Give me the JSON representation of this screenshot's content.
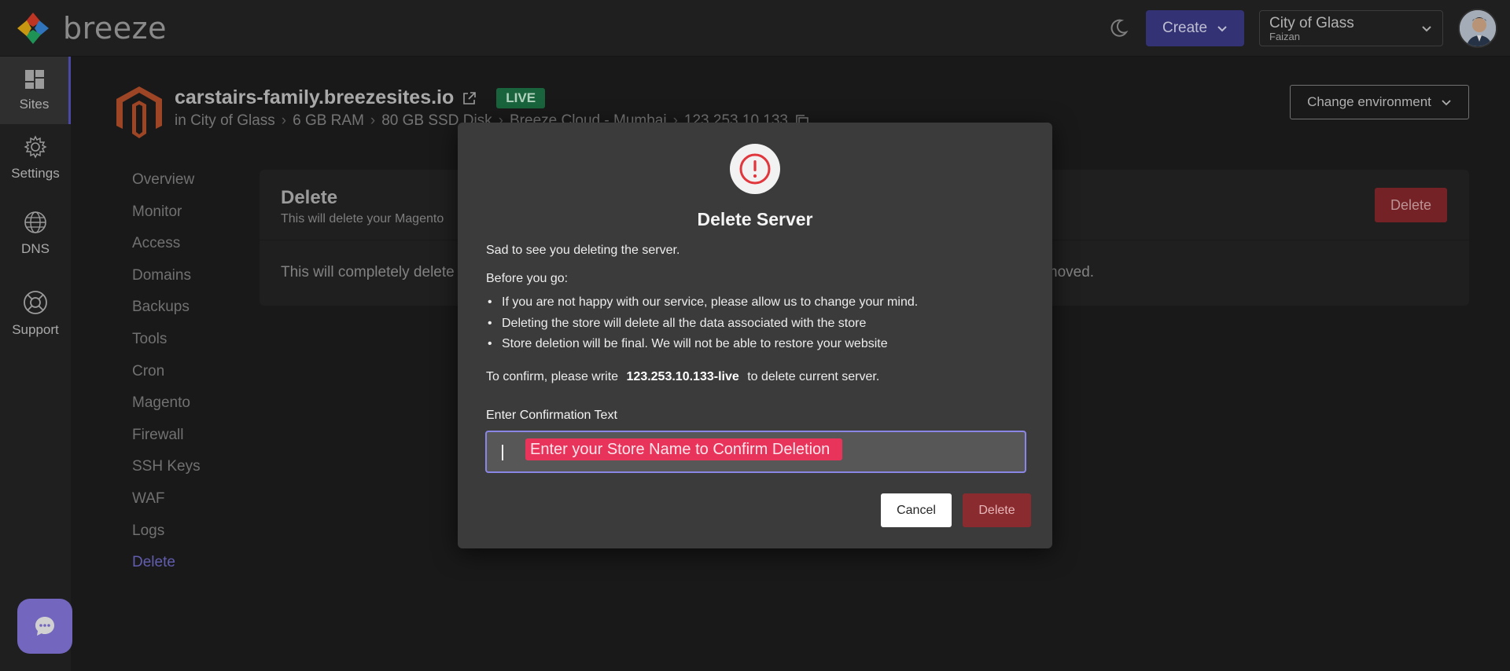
{
  "app": {
    "name": "breeze"
  },
  "header": {
    "create_label": "Create",
    "org_name": "City of Glass",
    "org_user": "Faizan"
  },
  "rail": [
    {
      "label": "Sites",
      "icon": "sites-icon"
    },
    {
      "label": "Settings",
      "icon": "gear-icon"
    },
    {
      "label": "DNS",
      "icon": "globe-icon"
    },
    {
      "label": "Support",
      "icon": "lifebuoy-icon"
    }
  ],
  "site": {
    "domain": "carstairs-family.breezesites.io",
    "status": "LIVE",
    "meta": [
      "in City of Glass",
      "6 GB RAM",
      "80 GB SSD Disk",
      "Breeze Cloud - Mumbai",
      "123.253.10.133"
    ],
    "change_env_label": "Change environment"
  },
  "sidenav": [
    "Overview",
    "Monitor",
    "Access",
    "Domains",
    "Backups",
    "Tools",
    "Cron",
    "Magento",
    "Firewall",
    "SSH Keys",
    "WAF",
    "Logs",
    "Delete"
  ],
  "card": {
    "title": "Delete",
    "subtitle": "This will delete your Magento",
    "delete_label": "Delete",
    "body_start": "This will completely delete",
    "body_end": "e removed."
  },
  "modal": {
    "title": "Delete Server",
    "intro": "Sad to see you deleting the server.",
    "before": "Before you go:",
    "bullets": [
      "If you are not happy with our service, please allow us to change your mind.",
      "Deleting the store will delete all the data associated with the store",
      "Store deletion will be final. We will not be able to restore your website"
    ],
    "confirm_prefix": "To confirm, please write",
    "confirm_token": "123.253.10.133-live",
    "confirm_suffix": "to delete current server.",
    "field_label": "Enter Confirmation Text",
    "field_hint": "Enter your Store Name to Confirm Deletion",
    "cancel_label": "Cancel",
    "delete_label": "Delete"
  },
  "colors": {
    "accent": "#3f3d8f",
    "live": "#1f7a4a",
    "danger": "#8a2c2f",
    "hint_tag": "#e8335a"
  }
}
